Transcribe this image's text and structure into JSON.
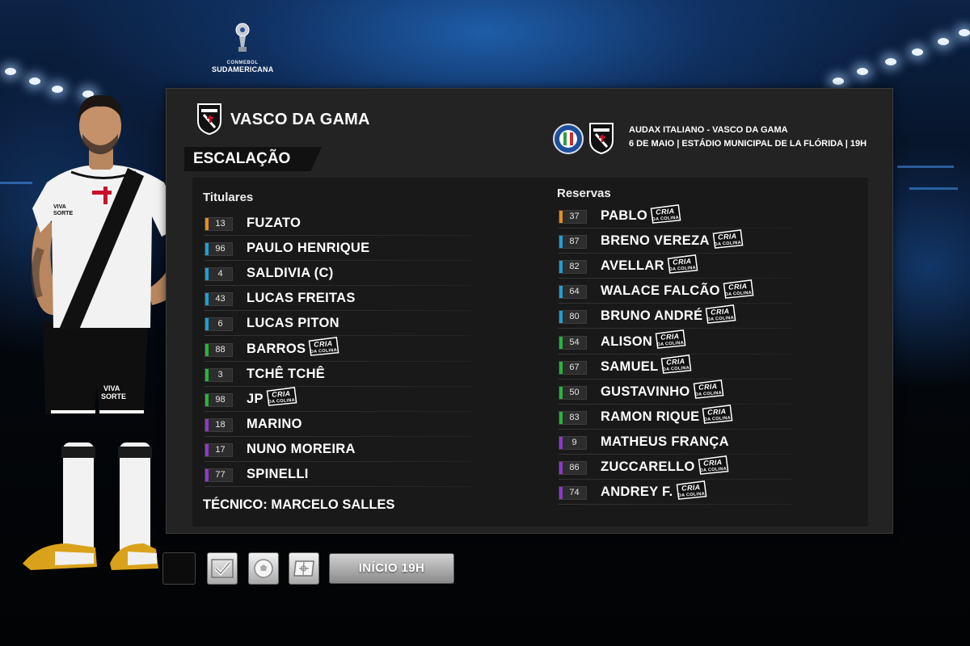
{
  "competition": {
    "pre": "CONMEBOL",
    "name": "SUDAMERICANA"
  },
  "club": {
    "name": "VASCO DA GAMA"
  },
  "section_title": "ESCALAÇÃO",
  "match": {
    "title": "AUDAX ITALIANO - VASCO DA GAMA",
    "info": "6 DE MAIO | ESTÁDIO MUNICIPAL DE LA FLÓRIDA | 19H"
  },
  "starters": {
    "title": "Titulares",
    "players": [
      {
        "number": "13",
        "name": "FUZATO",
        "color": "#e5901c",
        "cria": false
      },
      {
        "number": "96",
        "name": "PAULO HENRIQUE",
        "color": "#1f9fd6",
        "cria": false
      },
      {
        "number": "4",
        "name": "SALDIVIA (C)",
        "color": "#1f9fd6",
        "cria": false
      },
      {
        "number": "43",
        "name": "LUCAS FREITAS",
        "color": "#1f9fd6",
        "cria": false
      },
      {
        "number": "6",
        "name": "LUCAS PITON",
        "color": "#1f9fd6",
        "cria": false
      },
      {
        "number": "88",
        "name": "BARROS",
        "color": "#27b43a",
        "cria": true
      },
      {
        "number": "3",
        "name": "TCHÊ TCHÊ",
        "color": "#27b43a",
        "cria": false
      },
      {
        "number": "98",
        "name": "JP",
        "color": "#27b43a",
        "cria": true
      },
      {
        "number": "18",
        "name": "MARINO",
        "color": "#8d39c7",
        "cria": false
      },
      {
        "number": "17",
        "name": "NUNO MOREIRA",
        "color": "#8d39c7",
        "cria": false
      },
      {
        "number": "77",
        "name": "SPINELLI",
        "color": "#8d39c7",
        "cria": false
      }
    ]
  },
  "coach": "TÉCNICO: MARCELO SALLES",
  "reserves": {
    "title": "Reservas",
    "players": [
      {
        "number": "37",
        "name": "PABLO",
        "color": "#e5901c",
        "cria": true
      },
      {
        "number": "87",
        "name": "BRENO VEREZA",
        "color": "#1f9fd6",
        "cria": true
      },
      {
        "number": "82",
        "name": "AVELLAR",
        "color": "#1f9fd6",
        "cria": true
      },
      {
        "number": "64",
        "name": "WALACE FALCÃO",
        "color": "#1f9fd6",
        "cria": true
      },
      {
        "number": "80",
        "name": "BRUNO ANDRÉ",
        "color": "#1f9fd6",
        "cria": true
      },
      {
        "number": "54",
        "name": "ALISON",
        "color": "#27b43a",
        "cria": true
      },
      {
        "number": "67",
        "name": "SAMUEL",
        "color": "#27b43a",
        "cria": true
      },
      {
        "number": "50",
        "name": "GUSTAVINHO",
        "color": "#27b43a",
        "cria": true
      },
      {
        "number": "83",
        "name": "RAMON RIQUE",
        "color": "#27b43a",
        "cria": true
      },
      {
        "number": "9",
        "name": "MATHEUS FRANÇA",
        "color": "#8d39c7",
        "cria": false
      },
      {
        "number": "86",
        "name": "ZUCCARELLO",
        "color": "#8d39c7",
        "cria": true
      },
      {
        "number": "74",
        "name": "ANDREY F.",
        "color": "#8d39c7",
        "cria": true
      }
    ]
  },
  "cria_badge": {
    "line1": "CRIA",
    "line2": "DA COLINA"
  },
  "toolbar": {
    "start_label": "INÍCIO 19H",
    "icons": [
      "blank-slot",
      "checkmark-icon",
      "ball-icon",
      "pitch-icon"
    ]
  }
}
